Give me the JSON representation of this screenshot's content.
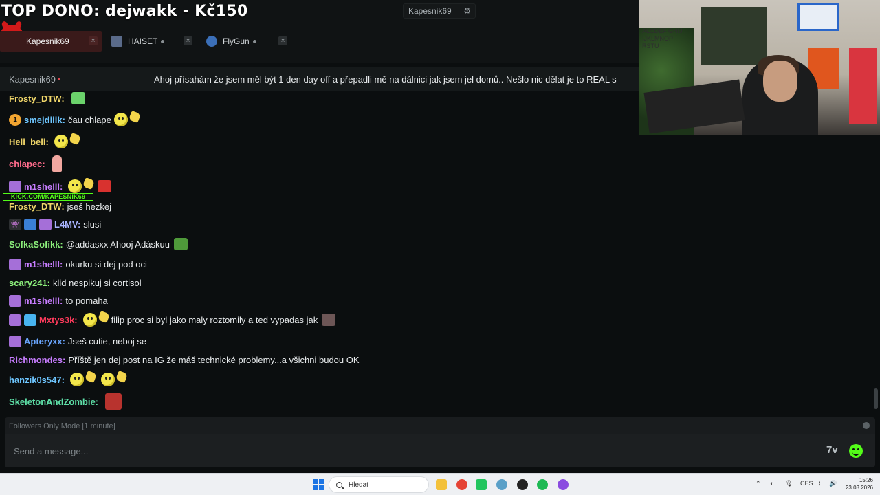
{
  "overlay": {
    "top_dono": "TOP DONO: dejwakk - Kč150"
  },
  "header": {
    "account_name": "Kapesnik69",
    "tabs": [
      {
        "label": "Kapesnik69",
        "color": "#d21a1a"
      },
      {
        "label": "HAISET",
        "color": "#5a6b8a"
      },
      {
        "label": "FlyGun",
        "color": "#3b6fb8"
      }
    ]
  },
  "pinned": {
    "author": "Kapesnik69",
    "message": "Ahoj přísahám že jsem měl být 1 den day off a přepadli mě na dálnici jak jsem jel domů.. Nešlo nic dělat je to REAL s"
  },
  "chat": {
    "kick_strip": "KICK.COM/KAPESNIK69",
    "messages": [
      {
        "user": "Frosty_DTW:",
        "color": "#f0d66a",
        "text": ""
      },
      {
        "user": "smejdiiik:",
        "color": "#6ec6ff",
        "text": "čau chlape"
      },
      {
        "user": "Heli_beli:",
        "color": "#f0d66a",
        "text": ""
      },
      {
        "user": "chlapec:",
        "color": "#ff6b8b",
        "text": ""
      },
      {
        "user": "m1shelll:",
        "color": "#c77dff",
        "text": ""
      },
      {
        "user": "Frosty_DTW:",
        "color": "#f0d66a",
        "text": "jseš hezkej"
      },
      {
        "user": "L4MV:",
        "color": "#a9b4ff",
        "text": "slusi"
      },
      {
        "user": "SofkaSofikk:",
        "color": "#8df07c",
        "text": "@addasxx Ahooj Adáskuu"
      },
      {
        "user": "m1shelll:",
        "color": "#c77dff",
        "text": "okurku si dej pod oci"
      },
      {
        "user": "scary241:",
        "color": "#8df07c",
        "text": "klid nespikuj si cortisol"
      },
      {
        "user": "m1shelll:",
        "color": "#c77dff",
        "text": "to pomaha"
      },
      {
        "user": "Mxtys3k:",
        "color": "#ff3b5c",
        "text": "filip proc si byl jako maly roztomily a ted vypadas jak"
      },
      {
        "user": "Apteryxx:",
        "color": "#6aa6ff",
        "text": "Jseš cutie, neboj se"
      },
      {
        "user": "Richmondes:",
        "color": "#c77dff",
        "text": "Příště jen dej post na IG že máš technické problemy...a všichni budou OK"
      },
      {
        "user": "hanzik0s547:",
        "color": "#6ec6ff",
        "text": ""
      },
      {
        "user": "SkeletonAndZombie:",
        "color": "#5ee0a8",
        "text": ""
      }
    ]
  },
  "footer": {
    "mode_label": "Followers Only Mode [1 minute]",
    "input_placeholder": "Send a message..."
  },
  "taskbar": {
    "search_label": "Hledat",
    "lang": "CES",
    "time": "15:26",
    "date": "23.03.2026"
  },
  "webcam": {
    "wall_text": "ALCDEF GHIJ IJKLMNOP RSTU"
  }
}
